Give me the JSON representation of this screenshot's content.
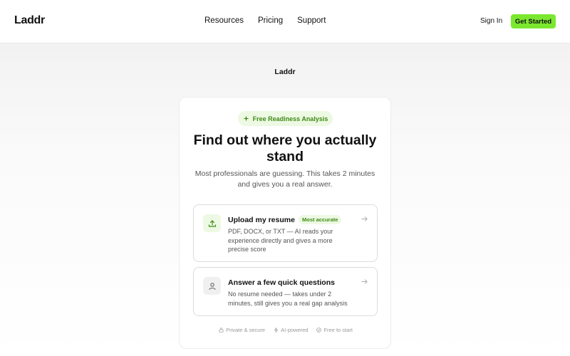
{
  "header": {
    "brand": "Laddr",
    "nav": [
      "Resources",
      "Pricing",
      "Support"
    ],
    "sign_in": "Sign In",
    "cta": "Get Started"
  },
  "main": {
    "logo": "Laddr",
    "badge": "Free Readiness Analysis",
    "title": "Find out where you actually stand",
    "subtitle": "Most professionals are guessing. This takes 2 minutes and gives you a real answer.",
    "options": [
      {
        "title": "Upload my resume",
        "tag": "Most accurate",
        "description": "PDF, DOCX, or TXT — AI reads your experience directly and gives a more precise score",
        "icon": "upload-icon"
      },
      {
        "title": "Answer a few quick questions",
        "description": "No resume needed — takes under 2 minutes, still gives you a real gap analysis",
        "icon": "user-icon"
      }
    ],
    "footer": [
      {
        "label": "Private & secure",
        "icon": "lock-icon"
      },
      {
        "label": "AI-powered",
        "icon": "bolt-icon"
      },
      {
        "label": "Free to start",
        "icon": "check-circle-icon"
      }
    ]
  },
  "colors": {
    "accent": "#7be82f",
    "accent_soft": "#edf9e3",
    "accent_text": "#3f8a16"
  }
}
